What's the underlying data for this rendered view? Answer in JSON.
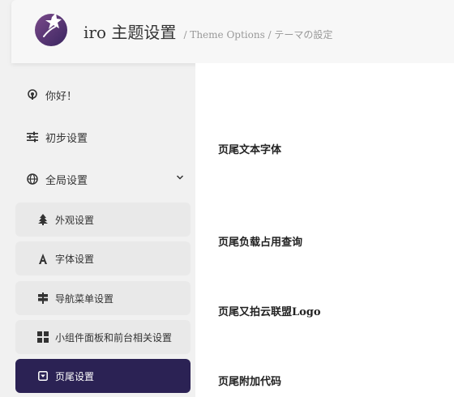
{
  "header": {
    "title": "iro 主题设置",
    "subtitle": "/ Theme Options / テーマの設定",
    "logo_icon": "iro-logo"
  },
  "sidebar": {
    "items": [
      {
        "label": "你好！",
        "icon": "podcast-icon"
      },
      {
        "label": "初步设置",
        "icon": "sliders-icon"
      },
      {
        "label": "全局设置",
        "icon": "globe-icon",
        "expanded": true
      }
    ],
    "sub_items": [
      {
        "label": "外观设置",
        "icon": "tree-icon"
      },
      {
        "label": "字体设置",
        "icon": "font-icon"
      },
      {
        "label": "导航菜单设置",
        "icon": "signpost-icon"
      },
      {
        "label": "小组件面板和前台相关设置",
        "icon": "grid-icon"
      },
      {
        "label": "页尾设置",
        "icon": "square-caret-down-icon",
        "active": true
      }
    ]
  },
  "content": {
    "fields": [
      "页尾文本字体",
      "页尾负载占用查询",
      "页尾又拍云联盟Logo",
      "页尾附加代码"
    ]
  },
  "colors": {
    "accent": "#2b2254",
    "sidebar_bg": "#f1f1f1",
    "sub_item_bg": "#e9e9e9",
    "content_bg": "#ffffff"
  }
}
